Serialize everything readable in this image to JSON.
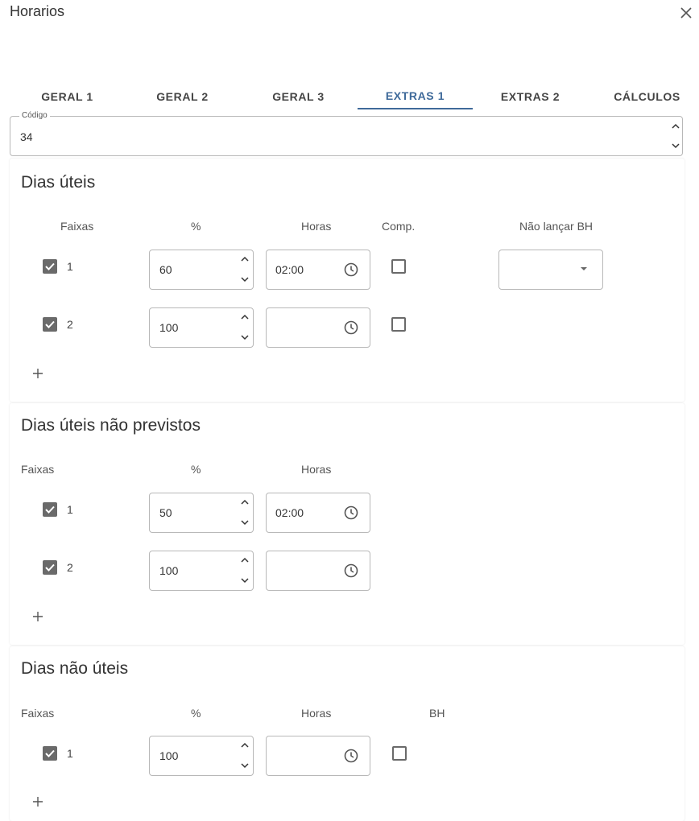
{
  "dialog": {
    "title": "Horarios"
  },
  "tabs": [
    {
      "label": "GERAL 1"
    },
    {
      "label": "GERAL 2"
    },
    {
      "label": "GERAL 3"
    },
    {
      "label": "EXTRAS 1",
      "active": true
    },
    {
      "label": "EXTRAS 2"
    },
    {
      "label": "CÁLCULOS"
    }
  ],
  "codigo": {
    "label": "Código",
    "value": "34"
  },
  "sections": {
    "dias_uteis": {
      "title": "Dias úteis",
      "headers": {
        "faixas": "Faixas",
        "percent": "%",
        "horas": "Horas",
        "comp": "Comp.",
        "nao_lancar_bh": "Não lançar BH"
      },
      "rows": [
        {
          "checked": true,
          "index": "1",
          "percent": "60",
          "horas": "02:00",
          "comp": false
        },
        {
          "checked": true,
          "index": "2",
          "percent": "100",
          "horas": "",
          "comp": false
        }
      ],
      "nao_lancar_bh_value": ""
    },
    "dias_uteis_nao_previstos": {
      "title": "Dias úteis não previstos",
      "headers": {
        "faixas": "Faixas",
        "percent": "%",
        "horas": "Horas"
      },
      "rows": [
        {
          "checked": true,
          "index": "1",
          "percent": "50",
          "horas": "02:00"
        },
        {
          "checked": true,
          "index": "2",
          "percent": "100",
          "horas": ""
        }
      ]
    },
    "dias_nao_uteis": {
      "title": "Dias não úteis",
      "headers": {
        "faixas": "Faixas",
        "percent": "%",
        "horas": "Horas",
        "bh": "BH"
      },
      "rows": [
        {
          "checked": true,
          "index": "1",
          "percent": "100",
          "horas": "",
          "bh": false
        }
      ]
    }
  },
  "colors": {
    "accent": "#3f6a9a",
    "checkbox": "#6a6a6a",
    "border": "#b8b8b8"
  }
}
